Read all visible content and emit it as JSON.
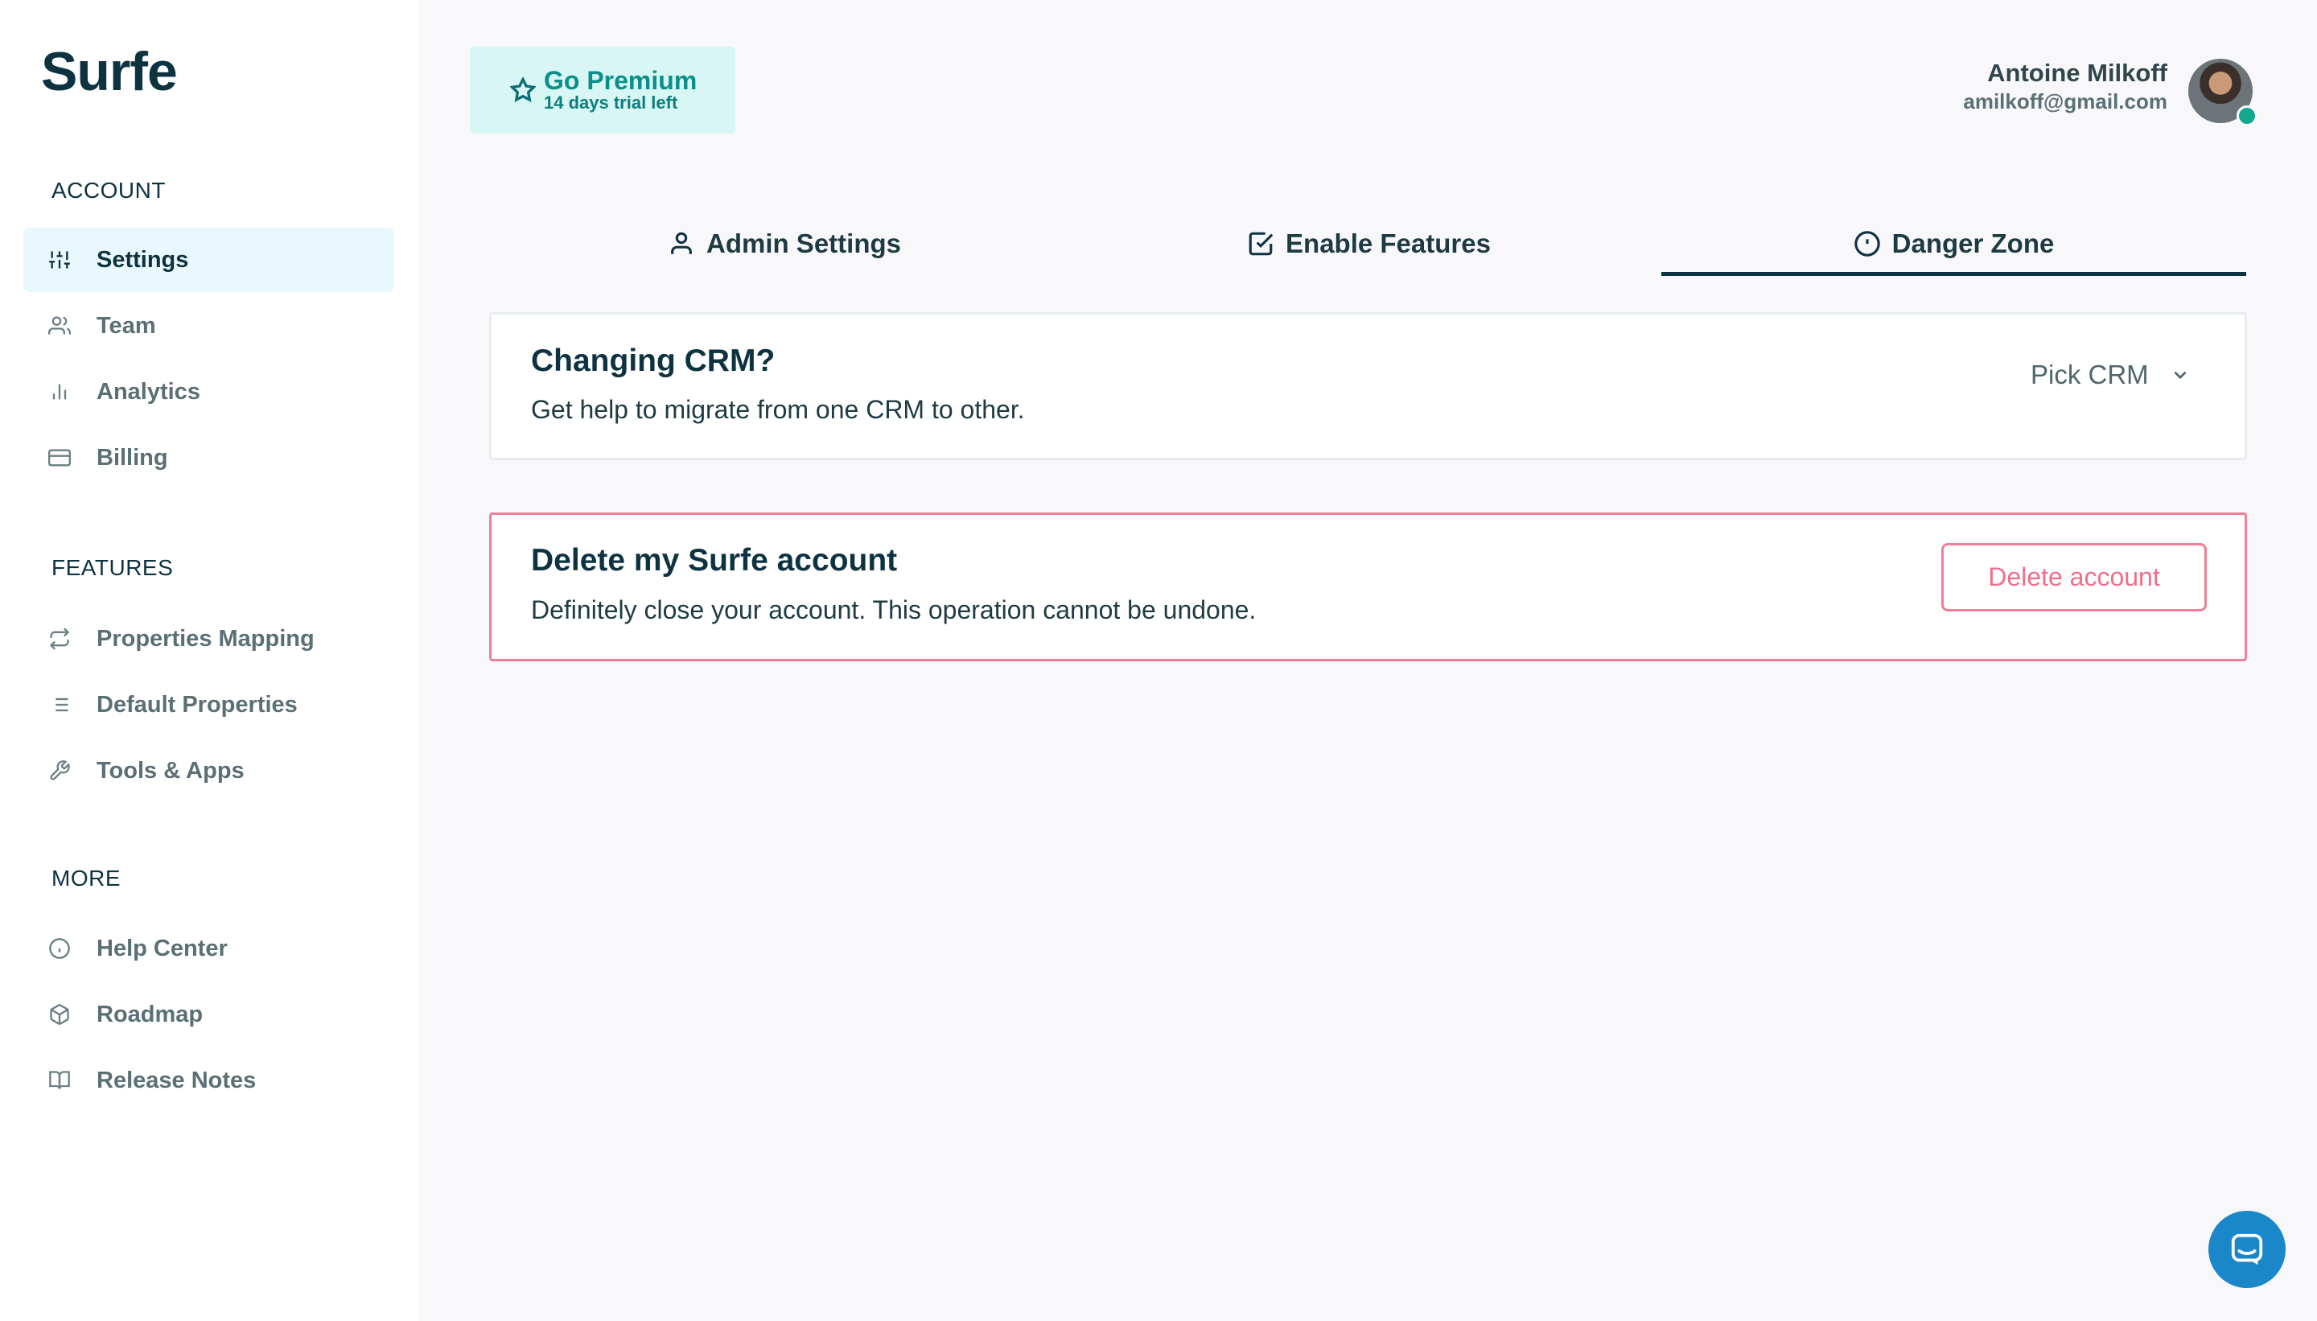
{
  "app": {
    "logo_text": "Surfe"
  },
  "sidebar": {
    "sections": [
      {
        "title": "ACCOUNT",
        "items": [
          {
            "label": "Settings",
            "icon": "sliders-icon",
            "active": true
          },
          {
            "label": "Team",
            "icon": "users-icon"
          },
          {
            "label": "Analytics",
            "icon": "bar-chart-icon"
          },
          {
            "label": "Billing",
            "icon": "credit-card-icon"
          }
        ]
      },
      {
        "title": "FEATURES",
        "items": [
          {
            "label": "Properties Mapping",
            "icon": "repeat-icon"
          },
          {
            "label": "Default Properties",
            "icon": "list-icon"
          },
          {
            "label": "Tools & Apps",
            "icon": "tool-icon"
          }
        ]
      },
      {
        "title": "MORE",
        "items": [
          {
            "label": "Help Center",
            "icon": "info-icon"
          },
          {
            "label": "Roadmap",
            "icon": "box-icon"
          },
          {
            "label": "Release Notes",
            "icon": "book-icon"
          }
        ]
      }
    ]
  },
  "header": {
    "premium": {
      "title": "Go Premium",
      "subtitle": "14 days trial left"
    },
    "user": {
      "name": "Antoine Milkoff",
      "email": "amilkoff@gmail.com",
      "status": "online"
    }
  },
  "tabs": [
    {
      "label": "Admin Settings",
      "icon": "user-icon"
    },
    {
      "label": "Enable Features",
      "icon": "check-square-icon"
    },
    {
      "label": "Danger Zone",
      "icon": "alert-circle-icon",
      "active": true
    }
  ],
  "crm_card": {
    "title": "Changing CRM?",
    "description": "Get help to migrate from one CRM to other.",
    "select_label": "Pick CRM"
  },
  "delete_card": {
    "title": "Delete my Surfe account",
    "description": "Definitely close your account. This operation cannot be undone.",
    "button_label": "Delete account"
  },
  "colors": {
    "primary": "#0d3340",
    "danger": "#ef7f96",
    "premium_bg": "#d8f6f4",
    "active_nav_bg": "#e9f8fd",
    "chat": "#1a87c9"
  }
}
